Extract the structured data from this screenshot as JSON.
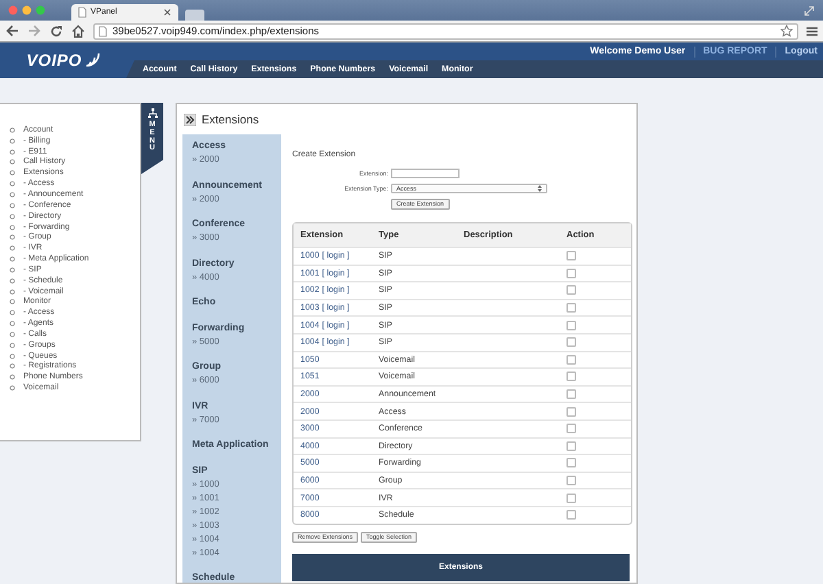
{
  "browser": {
    "tab_title": "VPanel",
    "url": "39be0527.voip949.com/index.php/extensions"
  },
  "header": {
    "logo": "VOIPO",
    "welcome": "Welcome Demo User",
    "links": [
      "BUG REPORT",
      "Logout"
    ],
    "nav": [
      "Account",
      "Call History",
      "Extensions",
      "Phone Numbers",
      "Voicemail",
      "Monitor"
    ]
  },
  "menu": {
    "tab_label": "MENU",
    "items": [
      {
        "label": "Account",
        "children": [
          {
            "label": "- Billing"
          },
          {
            "label": "- E911"
          }
        ]
      },
      {
        "label": "Call History"
      },
      {
        "label": "Extensions",
        "children": [
          {
            "label": "- Access"
          },
          {
            "label": "- Announcement"
          },
          {
            "label": "- Conference"
          },
          {
            "label": "- Directory"
          },
          {
            "label": "- Forwarding"
          },
          {
            "label": "- Group"
          },
          {
            "label": "- IVR"
          },
          {
            "label": "- Meta Application"
          },
          {
            "label": "- SIP"
          },
          {
            "label": "- Schedule"
          },
          {
            "label": "- Voicemail"
          }
        ]
      },
      {
        "label": "Monitor",
        "children": [
          {
            "label": "- Access"
          },
          {
            "label": "- Agents"
          },
          {
            "label": "- Calls"
          },
          {
            "label": "- Groups"
          },
          {
            "label": "- Queues"
          },
          {
            "label": "- Registrations"
          }
        ]
      },
      {
        "label": "Phone Numbers"
      },
      {
        "label": "Voicemail"
      }
    ]
  },
  "panel": {
    "title": "Extensions",
    "sidebar": [
      {
        "name": "Access",
        "items": [
          "» 2000"
        ]
      },
      {
        "name": "Announcement",
        "items": [
          "» 2000"
        ]
      },
      {
        "name": "Conference",
        "items": [
          "» 3000"
        ]
      },
      {
        "name": "Directory",
        "items": [
          "» 4000"
        ]
      },
      {
        "name": "Echo"
      },
      {
        "name": "Forwarding",
        "items": [
          "» 5000"
        ]
      },
      {
        "name": "Group",
        "items": [
          "» 6000"
        ]
      },
      {
        "name": "IVR",
        "items": [
          "» 7000"
        ]
      },
      {
        "name": "Meta Application"
      },
      {
        "name": "SIP",
        "items": [
          "» 1000",
          "» 1001",
          "» 1002",
          "» 1003",
          "» 1004",
          "» 1004"
        ]
      },
      {
        "name": "Schedule"
      }
    ],
    "create": {
      "heading": "Create Extension",
      "extension_label": "Extension:",
      "type_label": "Extension Type:",
      "type_value": "Access",
      "button": "Create Extension"
    },
    "table": {
      "columns": [
        "Extension",
        "Type",
        "Description",
        "Action"
      ],
      "rows": [
        {
          "extension": "1000",
          "login": "[ login ]",
          "type": "SIP",
          "checked": false
        },
        {
          "extension": "1001",
          "login": "[ login ]",
          "type": "SIP",
          "checked": false
        },
        {
          "extension": "1002",
          "login": "[ login ]",
          "type": "SIP",
          "checked": false
        },
        {
          "extension": "1003",
          "login": "[ login ]",
          "type": "SIP",
          "checked": false
        },
        {
          "extension": "1004",
          "login": "[ login ]",
          "type": "SIP",
          "checked": false
        },
        {
          "extension": "1004",
          "login": "[ login ]",
          "type": "SIP",
          "checked": false
        },
        {
          "extension": "1050",
          "type": "Voicemail",
          "checked": false
        },
        {
          "extension": "1051",
          "type": "Voicemail",
          "checked": false
        },
        {
          "extension": "2000",
          "type": "Announcement",
          "checked": false
        },
        {
          "extension": "2000",
          "type": "Access",
          "checked": false
        },
        {
          "extension": "3000",
          "type": "Conference",
          "checked": false
        },
        {
          "extension": "4000",
          "type": "Directory",
          "checked": false
        },
        {
          "extension": "5000",
          "type": "Forwarding",
          "checked": false
        },
        {
          "extension": "6000",
          "type": "Group",
          "checked": false
        },
        {
          "extension": "7000",
          "type": "IVR",
          "checked": false
        },
        {
          "extension": "8000",
          "type": "Schedule",
          "checked": false
        }
      ]
    },
    "buttons": [
      "Remove Extensions",
      "Toggle Selection"
    ],
    "footer_bar": "Extensions"
  }
}
